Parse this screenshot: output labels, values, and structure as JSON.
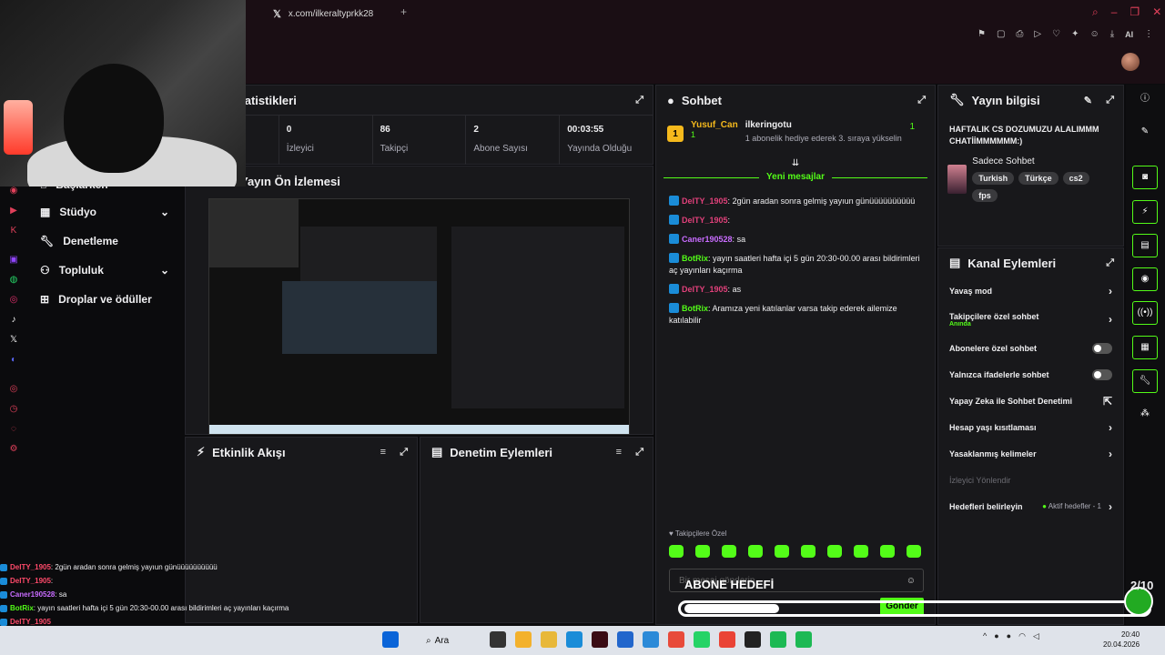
{
  "browser": {
    "tab_title": "x.com/ilkeraltyprkk28",
    "tab_icon": "x-icon",
    "ai_label": "AI"
  },
  "nav": {
    "items": [
      {
        "label": "Başlarken",
        "icon": "home-icon",
        "has_chevron": false
      },
      {
        "label": "Stüdyo",
        "icon": "grid-icon",
        "has_chevron": true
      },
      {
        "label": "Denetleme",
        "icon": "wrench-icon",
        "has_chevron": false
      },
      {
        "label": "Topluluk",
        "icon": "people-icon",
        "has_chevron": true
      },
      {
        "label": "Droplar ve ödüller",
        "icon": "gift-icon",
        "has_chevron": false
      }
    ]
  },
  "stats": {
    "title": "Yayın İstatistikleri",
    "items": [
      {
        "value": "",
        "label": ""
      },
      {
        "value": "0",
        "label": "İzleyici"
      },
      {
        "value": "86",
        "label": "Takipçi"
      },
      {
        "value": "2",
        "label": "Abone Sayısı"
      },
      {
        "value": "00:03:55",
        "label": "Yayında Olduğu Süre"
      }
    ]
  },
  "preview": {
    "title": "Yayın Ön İzlemesi"
  },
  "activity": {
    "title": "Etkinlik Akışı"
  },
  "mod_actions": {
    "title": "Denetim Eylemleri"
  },
  "chat": {
    "title": "Sohbet",
    "pinned": {
      "rank": "1",
      "user1": "Yusuf_Can",
      "user1_count": "1",
      "user2": "ilkeringotu",
      "user2_count": "1",
      "note": "1 abonelik hediye ederek 3. sıraya yükselin"
    },
    "new_messages_label": "Yeni mesajlar",
    "messages": [
      {
        "user": "DeITY_1905",
        "color": "#e0407a",
        "text": "2gün aradan sonra gelmiş yayıun günüüüüüüüüüü"
      },
      {
        "user": "DeITY_1905",
        "color": "#e0407a",
        "text": ""
      },
      {
        "user": "Caner190528",
        "color": "#c86cff",
        "text": "sa"
      },
      {
        "user": "BotRix",
        "color": "#53fc18",
        "text": "yayın saatleri hafta içi 5 gün 20:30-00.00 arası bildirimleri aç yayınları kaçırma"
      },
      {
        "user": "DeITY_1905",
        "color": "#e0407a",
        "text": "as"
      },
      {
        "user": "BotRix",
        "color": "#53fc18",
        "text": "Aramıza yeni katılanlar varsa takip ederek ailemize katılabilir"
      }
    ],
    "followers_label": "Takipçilere Özel",
    "input_placeholder": "Bir mesaj gönderin",
    "send_label": "Gönder"
  },
  "stream_info": {
    "title": "Yayın bilgisi",
    "stream_title": "HAFTALIK CS DOZUMUZU ALALIMMM CHATİİMMMMMM:)",
    "category": "Sadece Sohbet",
    "tags": [
      "Turkish",
      "Türkçe",
      "cs2",
      "fps"
    ]
  },
  "channel_actions": {
    "title": "Kanal Eylemleri",
    "rows": [
      {
        "label": "Yavaş mod",
        "sub": "",
        "control": "chevron"
      },
      {
        "label": "Takipçilere özel sohbet",
        "sub": "Anında",
        "control": "chevron"
      },
      {
        "label": "Abonelere özel sohbet",
        "sub": "",
        "control": "toggle"
      },
      {
        "label": "Yalnızca ifadelerle sohbet",
        "sub": "",
        "control": "toggle"
      },
      {
        "label": "Yapay Zeka ile Sohbet Denetimi",
        "sub": "",
        "control": "external"
      },
      {
        "label": "Hesap yaşı kısıtlaması",
        "sub": "",
        "control": "chevron"
      },
      {
        "label": "Yasaklanmış kelimeler",
        "sub": "",
        "control": "chevron"
      }
    ],
    "section_label": "İzleyici Yönlendir",
    "goals_label": "Hedefleri belirleyin",
    "goals_status": "Aktif hedefler - 1"
  },
  "overlay": {
    "chat": [
      {
        "user": "DeITY_1905",
        "color": "#ff4a6a",
        "text": ": 2gün aradan sonra gelmiş yayıun günüüüüüüüüüü"
      },
      {
        "user": "DeITY_1905",
        "color": "#ff4a6a",
        "text": ":"
      },
      {
        "user": "Caner190528",
        "color": "#c86cff",
        "text": ": sa"
      },
      {
        "user": "BotRix",
        "color": "#53fc18",
        "text": ": yayın saatleri hafta içi 5 gün 20:30-00.00 arası bildirimleri aç yayınları kaçırma"
      },
      {
        "user": "DeITY_1905",
        "color": "#ff4a6a",
        "text": ""
      }
    ],
    "goal_name": "ABONE HEDEFİ",
    "goal_counter": "2/10",
    "goal_progress": 0.2
  },
  "taskbar": {
    "search_label": "Ara",
    "time": "20:40",
    "date": "20.04.2026"
  },
  "colors": {
    "accent": "#53fc18",
    "panel": "#18181b",
    "bg": "#0b0b0d"
  }
}
